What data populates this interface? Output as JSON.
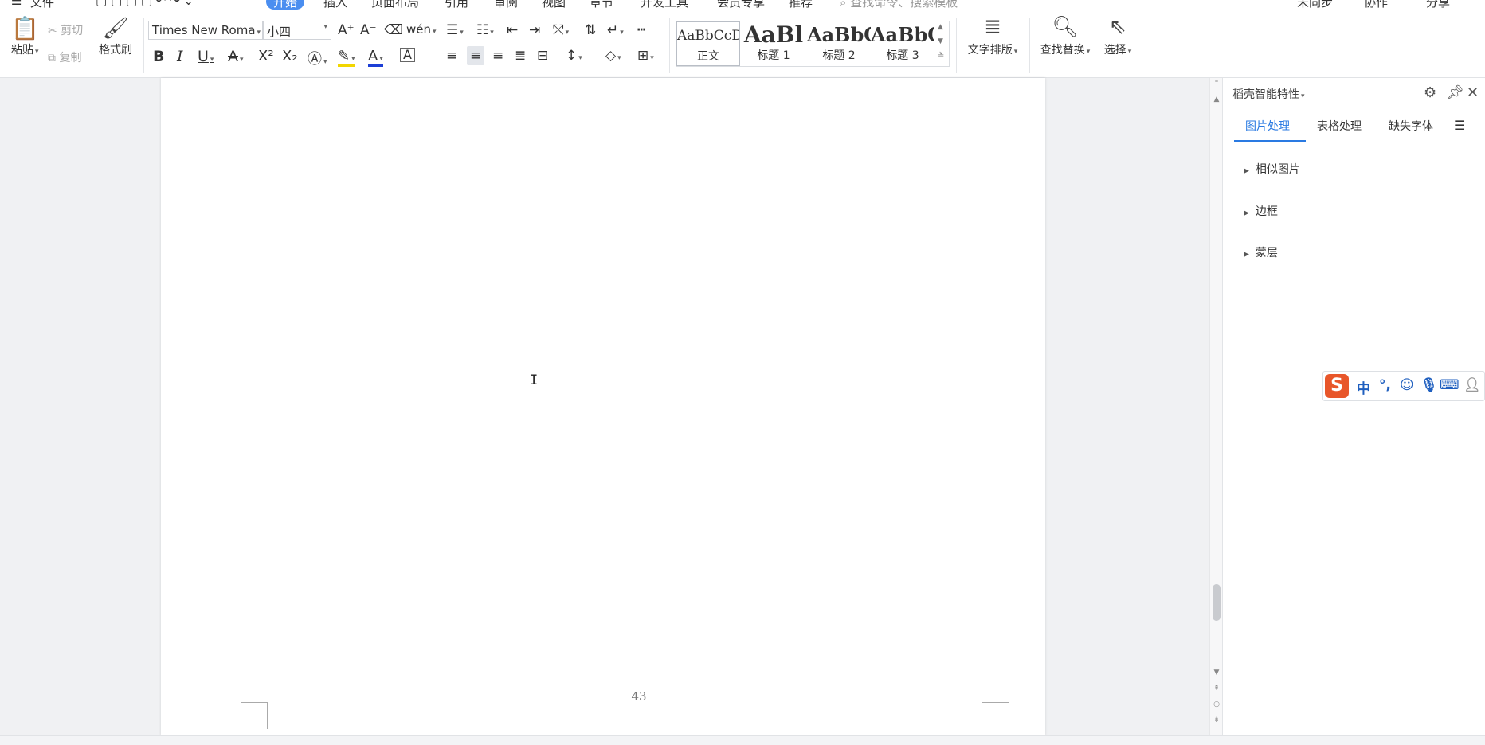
{
  "menubar": {
    "file": "文件",
    "tabs": [
      "开始",
      "插入",
      "页面布局",
      "引用",
      "审阅",
      "视图",
      "章节",
      "开发工具",
      "会员专享",
      "推荐"
    ],
    "active_tab": "开始",
    "search_placeholder": "查找命令、搜索模板",
    "right": [
      "未同步",
      "协作",
      "分享"
    ]
  },
  "ribbon": {
    "paste": "粘贴",
    "cut": "剪切",
    "copy": "复制",
    "format_painter": "格式刷",
    "font_name": "Times New Roma",
    "font_size": "小四",
    "styles": [
      {
        "sample": "AaBbCcD",
        "name": "正文"
      },
      {
        "sample": "AaBl",
        "name": "标题 1"
      },
      {
        "sample": "AaBbC",
        "name": "标题 2"
      },
      {
        "sample": "AaBbC",
        "name": "标题 3"
      }
    ],
    "text_layout": "文字排版",
    "find_replace": "查找替换",
    "select": "选择"
  },
  "document": {
    "page_number": "43"
  },
  "pane": {
    "title": "稻壳智能特性",
    "tabs": [
      "图片处理",
      "表格处理",
      "缺失字体"
    ],
    "active_tab": "图片处理",
    "sections": [
      "相似图片",
      "边框",
      "蒙层"
    ]
  },
  "ime": {
    "logo": "S",
    "mode": "中",
    "punct": "°,"
  },
  "colors": {
    "accent": "#2a7ae2",
    "tab_active_bg": "#4a8ef0",
    "ime_logo": "#e8562a"
  }
}
